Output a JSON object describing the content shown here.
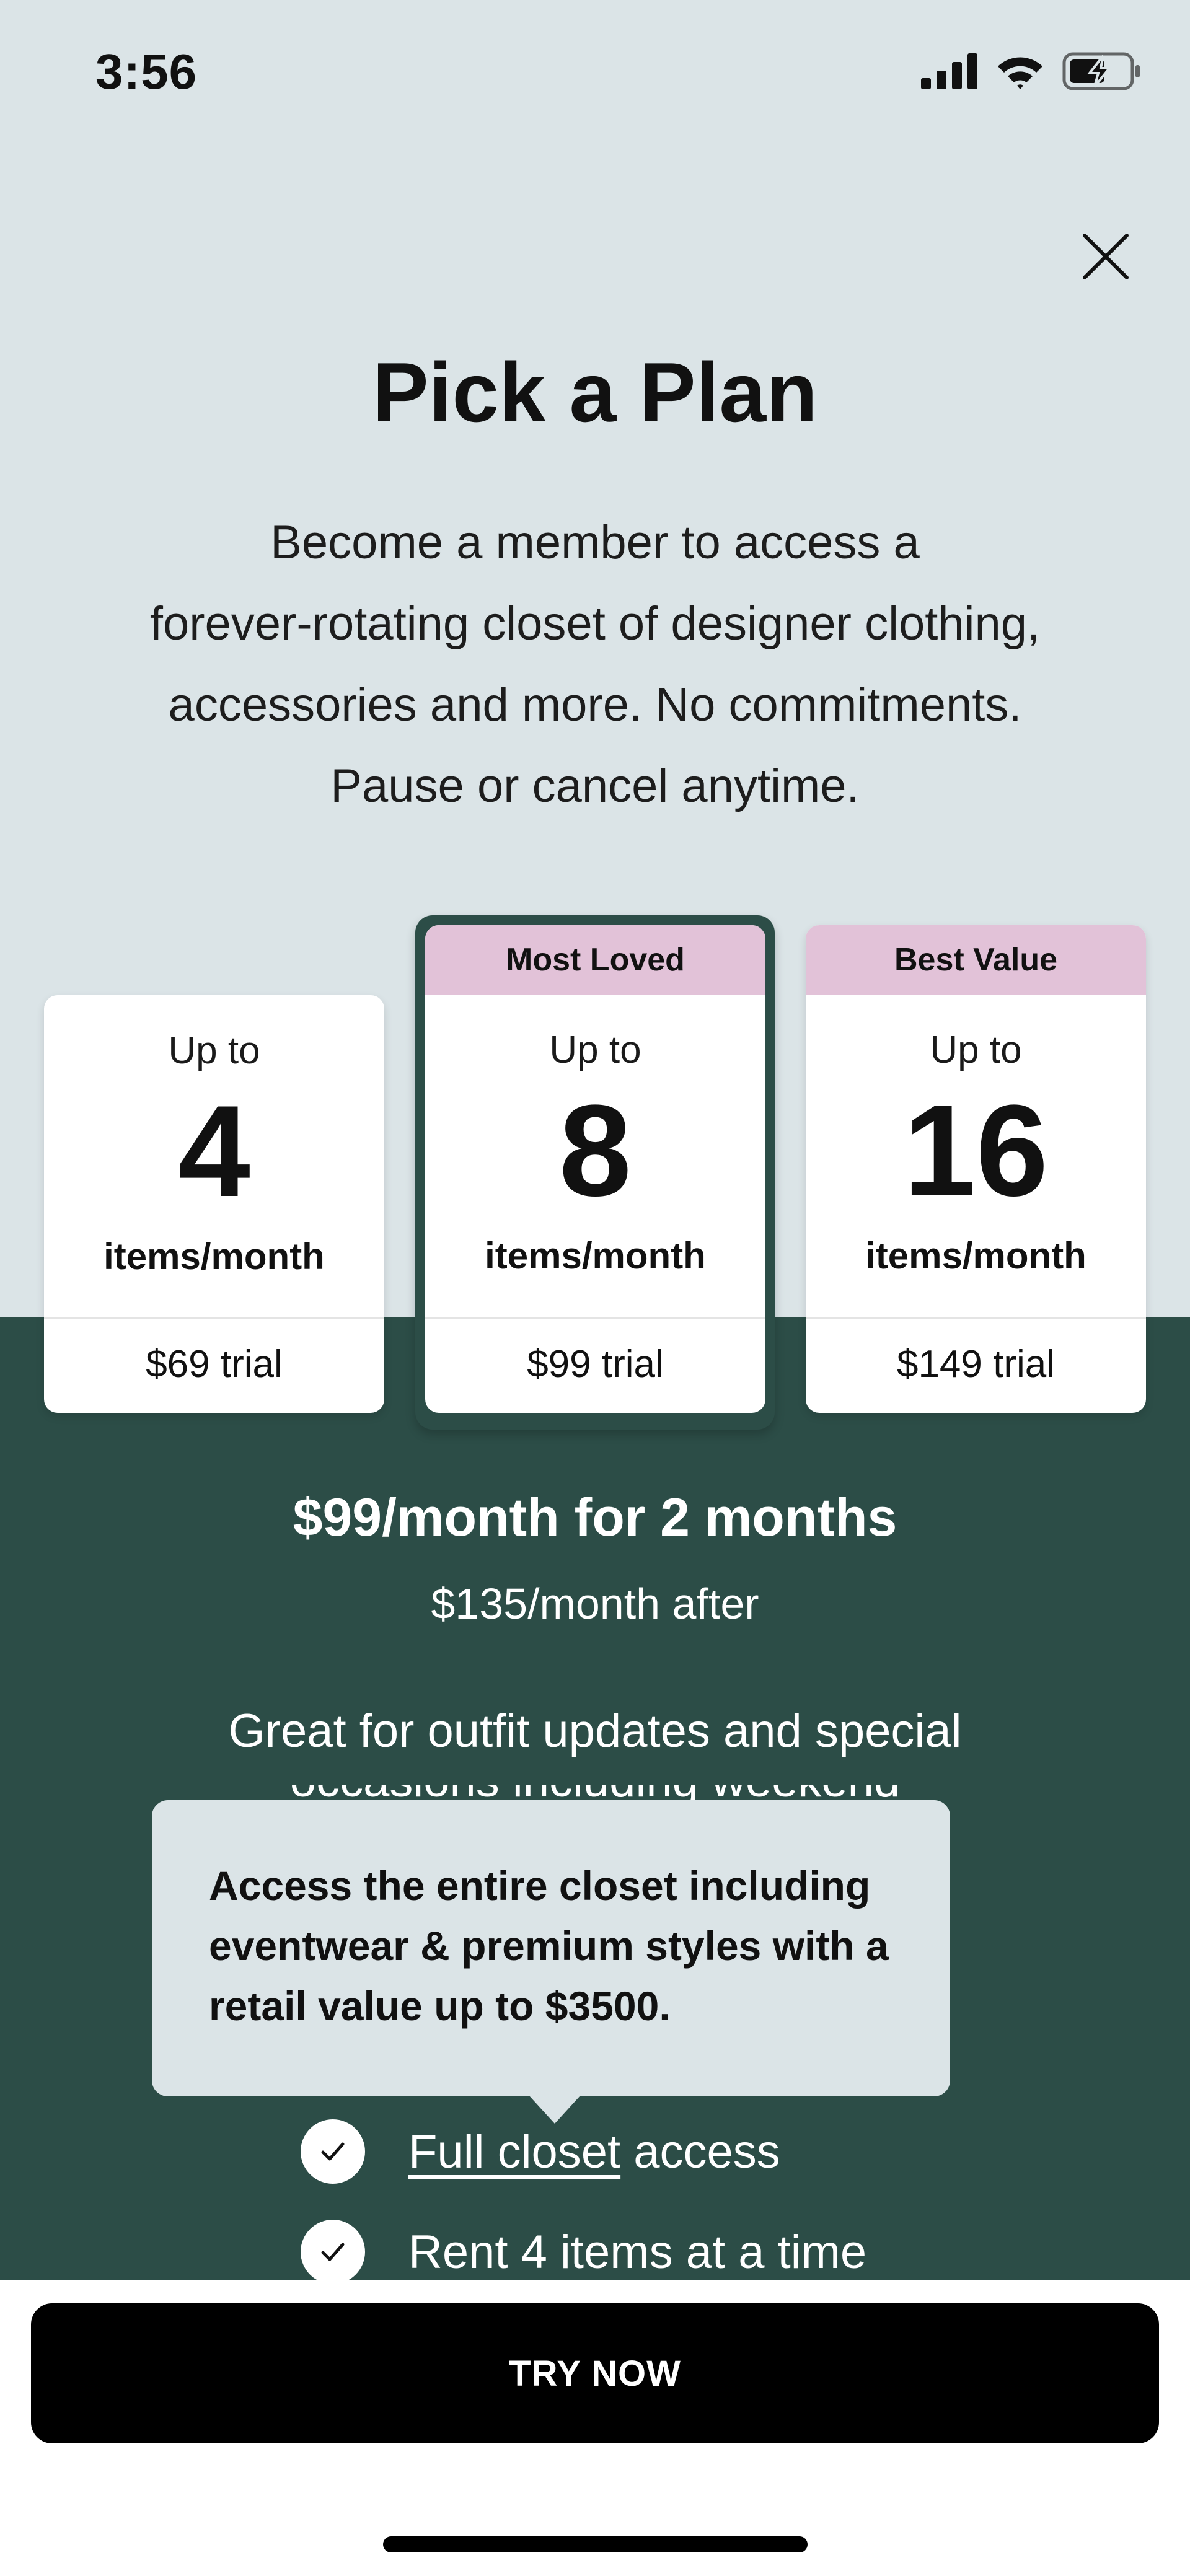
{
  "status_bar": {
    "time": "3:56"
  },
  "header": {
    "title": "Pick a Plan",
    "description_lines": [
      "Become a member to access a",
      "forever-rotating closet of designer clothing,",
      "accessories and more. No commitments.",
      "Pause or cancel anytime."
    ]
  },
  "plans": [
    {
      "badge": "",
      "up_to": "Up to",
      "items": "4",
      "unit": "items/month",
      "price": "$69 trial",
      "selected": false
    },
    {
      "badge": "Most Loved",
      "up_to": "Up to",
      "items": "8",
      "unit": "items/month",
      "price": "$99 trial",
      "selected": true
    },
    {
      "badge": "Best Value",
      "up_to": "Up to",
      "items": "16",
      "unit": "items/month",
      "price": "$149 trial",
      "selected": false
    }
  ],
  "promo": {
    "main": "$99/month for 2 months",
    "after": "$135/month after",
    "line1": "Great for outfit updates and special",
    "line2": "occasions including weekend"
  },
  "tooltip": {
    "text": "Access the entire closet including eventwear & premium styles with a retail value up to $3500."
  },
  "features": [
    {
      "link_text": "Full closet",
      "rest": " access"
    },
    {
      "text": "Rent 4 items at a time"
    }
  ],
  "cta": {
    "label": "TRY NOW"
  },
  "colors": {
    "top_bg": "#dbe4e7",
    "dark_green": "#2c4d47",
    "badge_pink": "#e2c2d8",
    "cta_black": "#000000"
  },
  "icons": [
    "signal-icon",
    "wifi-icon",
    "battery-charging-icon",
    "close-icon",
    "check-icon"
  ]
}
